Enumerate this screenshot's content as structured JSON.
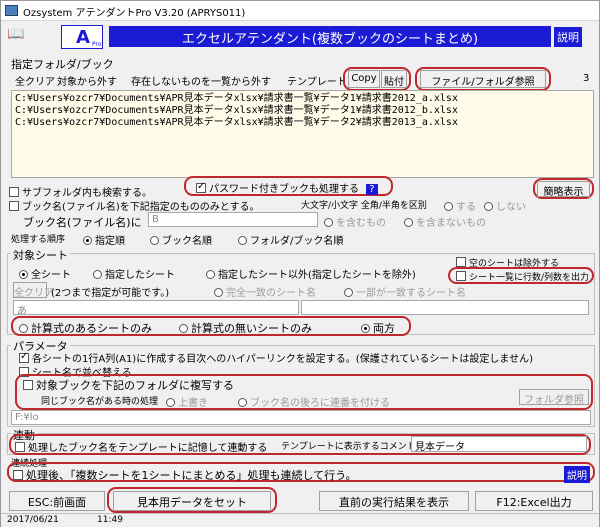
{
  "window": {
    "title": "Ozsystem アテンダントPro V3.20 (APRYS011)"
  },
  "header": {
    "banner": "エクセルアテンダント(複数ブックのシートまとめ)",
    "help_label": "説明",
    "logo_letter": "A",
    "logo_sub": "Pro"
  },
  "folder_section": {
    "title": "指定フォルダ/ブック",
    "buttons": {
      "clear": "全クリア",
      "remove": "対象から外す",
      "remove_missing": "存在しないものを一覧から外す",
      "template": "テンプレート",
      "copy": "Copy",
      "paste": "貼付",
      "browse": "ファイル/フォルダ参照"
    },
    "count": "3",
    "files": [
      "C:¥Users¥ozcr7¥Documents¥APR見本データxlsx¥請求書一覧¥データ1¥請求書2012_a.xlsx",
      "C:¥Users¥ozcr7¥Documents¥APR見本データxlsx¥請求書一覧¥データ1¥請求書2012_b.xlsx",
      "C:¥Users¥ozcr7¥Documents¥APR見本データxlsx¥請求書一覧¥データ2¥請求書2013_a.xlsx"
    ],
    "subfolder_label": "サブフォルダ内も検索する。",
    "password_label": "パスワード付きブックも処理する",
    "password_help": "?",
    "simple_view": "簡略表示",
    "book_filter_label": "ブック名(ファイル名)を下記指定のもののみとする。",
    "case_label": "大文字/小文字 全角/半角を区別",
    "case_yes": "する",
    "case_no": "しない",
    "book_name_label": "ブック名(ファイル名)に",
    "book_name_value": "B",
    "contains": "を含むもの",
    "not_contains": "を含まないもの",
    "order_label": "処理する順序",
    "order_options": [
      "指定順",
      "ブック名順",
      "フォルダ/ブック名順"
    ]
  },
  "sheet_section": {
    "title": "対象シート",
    "scope_options": [
      "全シート",
      "指定したシート",
      "指定したシート以外(指定したシートを除外)"
    ],
    "exclude_empty": "空のシートは除外する",
    "sheet_list_label": "シート一覧に行数/列数を出力",
    "clear": "全クリア",
    "clear_note": "(2つまで指定が可能です。)",
    "match_exact": "完全一致のシート名",
    "match_partial": "一部が一致するシート名",
    "sheet_value": "あ",
    "formula_options": [
      "計算式のあるシートのみ",
      "計算式の無いシートのみ",
      "両方"
    ]
  },
  "param_section": {
    "title": "パラメータ",
    "hyperlink_label": "各シートの1行A列(A1)に作成する目次へのハイパーリンクを設定する。(保護されているシートは設定しません)",
    "sort_label": "シート名で並べ替える",
    "copy_label": "対象ブックを下記のフォルダに複写する",
    "same_name_label": "同じブック名がある時の処理",
    "overwrite": "上書き",
    "append_seq": "ブック名の後ろに連番を付ける",
    "folder_browse": "フォルダ参照",
    "folder_value": "F:¥lo"
  },
  "link_section": {
    "title": "連動",
    "template_label": "処理したブック名をテンプレートに記憶して連動する",
    "comment_label": "テンプレートに表示するコメント",
    "comment_value": "見本データ"
  },
  "continuous_section": {
    "title": "連続処理",
    "continue_label": "処理後、「複数シートを1シートにまとめる」処理も連続して行う。",
    "help_label": "説明"
  },
  "footer_buttons": {
    "esc": "ESC:前画面",
    "sample": "見本用データをセット",
    "prev_result": "直前の実行結果を表示",
    "excel": "F12:Excel出力"
  },
  "status": {
    "date": "2017/06/21",
    "time": "11:49"
  }
}
